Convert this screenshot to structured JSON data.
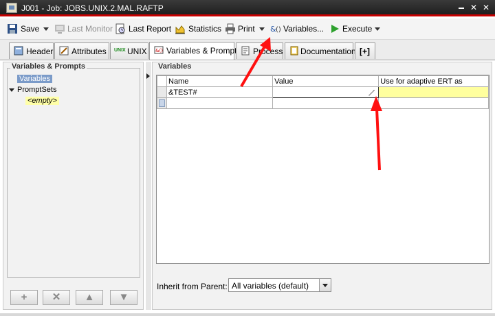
{
  "window": {
    "title": "J001 - Job: JOBS.UNIX.2.MAL.RAFTP"
  },
  "toolbar": {
    "save": "Save",
    "last_monitor": "Last Monitor",
    "last_report": "Last Report",
    "statistics": "Statistics",
    "print": "Print",
    "variables": "Variables...",
    "execute": "Execute"
  },
  "tabs": [
    {
      "label": "Header",
      "icon": "header-icon"
    },
    {
      "label": "Attributes",
      "icon": "attributes-icon"
    },
    {
      "label": "UNIX",
      "icon": "unix-icon",
      "badge": "UNIX"
    },
    {
      "label": "Variables & Prompts",
      "icon": "variables-prompts-icon",
      "active": true
    },
    {
      "label": "Process",
      "icon": "process-icon"
    },
    {
      "label": "Documentation",
      "icon": "documentation-icon"
    },
    {
      "label": "[+]",
      "icon": "add-tab-icon"
    }
  ],
  "left": {
    "group_title": "Variables & Prompts",
    "tree": {
      "variables": "Variables",
      "promptsets": "PromptSets",
      "empty": "<empty>"
    },
    "buttons": [
      "+",
      "✕",
      "▲",
      "▼"
    ]
  },
  "right": {
    "group_title": "Variables",
    "columns": [
      "Name",
      "Value",
      "Use for adaptive ERT as"
    ],
    "rows": [
      {
        "name": "&TEST#",
        "value": "",
        "ert": ""
      },
      {
        "name": "",
        "value": "",
        "ert": ""
      }
    ],
    "inherit_label": "Inherit from Parent:",
    "inherit_value": "All variables (default)"
  },
  "colors": {
    "title_accent": "#c80000",
    "annotation_arrow": "#ff1010",
    "selection": "#7b9bc9",
    "highlight_yellow": "#ffff9e"
  }
}
